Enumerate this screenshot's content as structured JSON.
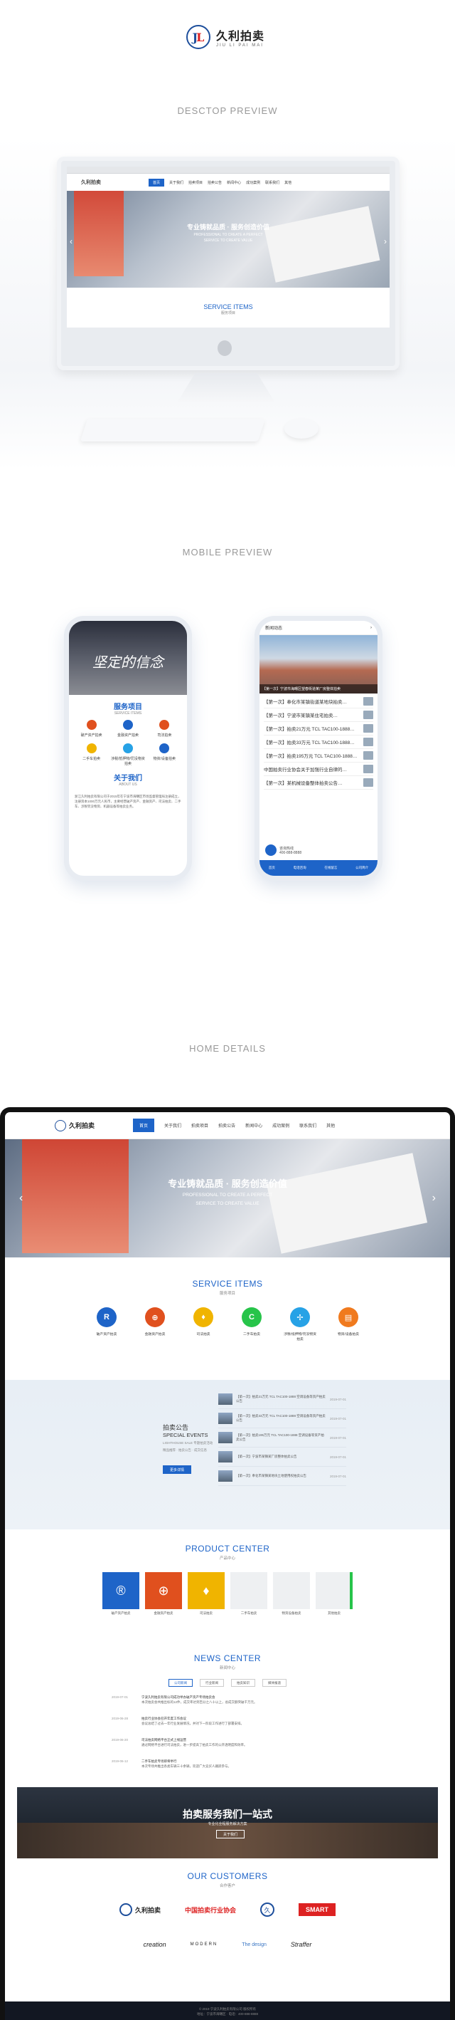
{
  "brand": {
    "name_cn": "久利拍卖",
    "name_en": "JIU LI PAI MAI"
  },
  "sections": {
    "desktop": "DESCTOP PREVIEW",
    "mobile": "MOBILE PREVIEW",
    "home": "HOME DETAILS"
  },
  "nav": {
    "items": [
      "首页",
      "关于我们",
      "拍卖项目",
      "拍卖公告",
      "新闻中心",
      "成功案例",
      "联系我们",
      "其他"
    ],
    "active": "首页"
  },
  "hero": {
    "title": "专业铸就品质 · 服务创造价值",
    "en_line1": "PROFESSIONAL TO CREATE A PERFECT",
    "en_line2": "SERVICE TO CREATE VALUE",
    "prev": "‹",
    "next": "›"
  },
  "services": {
    "title": "SERVICE ITEMS",
    "subtitle": "服务项目",
    "items": [
      {
        "label": "破产资产拍卖",
        "color": "#1e64c8",
        "glyph": "R"
      },
      {
        "label": "金融资产拍卖",
        "color": "#e0501e",
        "glyph": "⊕"
      },
      {
        "label": "司法拍卖",
        "color": "#f0b400",
        "glyph": "♦"
      },
      {
        "label": "二手车拍卖",
        "color": "#27c44a",
        "glyph": "C"
      },
      {
        "label": "涉税/抵押物/罚没物资拍卖",
        "color": "#27a2e6",
        "glyph": "✢"
      },
      {
        "label": "物资/设备拍卖",
        "color": "#f07a1e",
        "glyph": "▤"
      }
    ]
  },
  "mobile": {
    "slogan": "坚定的信念",
    "service_title": "服务项目",
    "service_sub": "SERVICE ITEMS",
    "cells": [
      "破产资产拍卖",
      "金融资产拍卖",
      "司法拍卖",
      "二手车拍卖",
      "涉税/抵押物/罚没物资拍卖",
      "物资/设备拍卖"
    ],
    "about_title": "关于我们",
    "about_sub": "ABOUT US",
    "about_text": "浙江久利拍卖有限公司于2015年在宁波市海曙区市场监督管理局注册成立，注册资本1000万元人民币，主要经营破产资产、金融资产、司法拍卖、二手车、涉税罚没物资、机器设备等拍卖业务。",
    "news_header": "新闻动态",
    "news_caption": "【第一次】宁波市海曙区望春街道某厂房整体拍卖",
    "news_items": [
      "【第一次】奉化市某镇街道某地块拍卖…",
      "【第一次】宁波市某镇某住宅拍卖…",
      "【第一次】拍卖21万元 TCL TAC100-1888…",
      "【第一次】拍卖33万元 TCL TAC100-1888…",
      "【第一次】拍卖195万元 TCL TAC100-1888…",
      "中国拍卖行业协会关于加强行业自律的…",
      "【第一次】某机械设备整体拍卖公告…"
    ],
    "tel_label": "咨询热线",
    "tel": "400-888-8888",
    "foot": [
      "首页",
      "电话咨询",
      "在线留言",
      "公司简介"
    ]
  },
  "events": {
    "title_cn": "拍卖公告",
    "title_en": "SPECIAL EVENTS",
    "line1": "LIGHTHOUSE SALE 专题拍卖活动",
    "line2": "精品推荐 · 拍卖公告 · 成交信息",
    "btn": "更多详情",
    "items": [
      {
        "t": "【第一次】拍卖21万元 TCL TAC100-1888 空调设备等资产拍卖公告",
        "d": "2019-07-01"
      },
      {
        "t": "【第一次】拍卖33万元 TCL TAC100-1888 空调设备等资产拍卖公告",
        "d": "2019-07-01"
      },
      {
        "t": "【第一次】拍卖195万元 TCL TAC100-1888 空调设备等资产拍卖公告",
        "d": "2019-07-01"
      },
      {
        "t": "【第一次】宁波市某镇某厂房整体拍卖公告",
        "d": "2019-07-01"
      },
      {
        "t": "【第一次】奉化市某镇某地块土地使用权拍卖公告",
        "d": "2019-07-01"
      }
    ]
  },
  "products": {
    "title": "PRODUCT CENTER",
    "subtitle": "产品中心",
    "items": [
      {
        "label": "破产资产拍卖",
        "color": "#1e64c8",
        "glyph": "®"
      },
      {
        "label": "金融资产拍卖",
        "color": "#e0501e",
        "glyph": "⊕"
      },
      {
        "label": "司法拍卖",
        "color": "#f0b400",
        "glyph": "♦"
      },
      {
        "label": "二手车拍卖",
        "color": "#eef0f2",
        "glyph": ""
      },
      {
        "label": "物资设备拍卖",
        "color": "#eef0f2",
        "glyph": ""
      },
      {
        "label": "其他拍卖",
        "color": "#eef0f2",
        "glyph": ""
      }
    ]
  },
  "news": {
    "title": "NEWS CENTER",
    "subtitle": "新闻中心",
    "tabs": [
      "公司新闻",
      "行业新闻",
      "拍卖知识",
      "媒体报道"
    ],
    "items": [
      {
        "d": "2019-07-01",
        "t": "宁波久利拍卖有限公司成功举办破产资产专场拍卖会",
        "b": "本次拍卖会共推出标的12件，成交率达到百分之八十以上，总成交额突破千万元。"
      },
      {
        "d": "2019-06-28",
        "t": "拍卖行业协会召开年度工作会议",
        "b": "会议总结了过去一年行业发展情况，并对下一阶段工作进行了部署安排。"
      },
      {
        "d": "2019-06-20",
        "t": "司法拍卖网络平台正式上线运营",
        "b": "通过网络平台进行司法拍卖，进一步提高了拍卖工作的公开透明度和效率。"
      },
      {
        "d": "2019-06-12",
        "t": "二手车拍卖专场即将举行",
        "b": "本次专场共推出各类车辆三十余辆，欢迎广大竞买人踊跃参与。"
      }
    ]
  },
  "banner": {
    "title": "拍卖服务我们一站式",
    "sub": "专业化全程服务解决方案",
    "btn": "关于我们"
  },
  "customers": {
    "title": "OUR CUSTOMERS",
    "subtitle": "合作客户",
    "row1": [
      "久利拍卖",
      "中国拍卖行业协会",
      "久",
      "SMART"
    ],
    "row2": [
      "creation",
      "MODERN",
      "The design",
      "Straffer"
    ]
  },
  "footer": {
    "line1": "© 2019 宁波久利拍卖有限公司 版权所有",
    "line2": "地址：宁波市海曙区 · 电话：400-888-8888"
  },
  "colors": {
    "accent": "#1e64c8"
  }
}
